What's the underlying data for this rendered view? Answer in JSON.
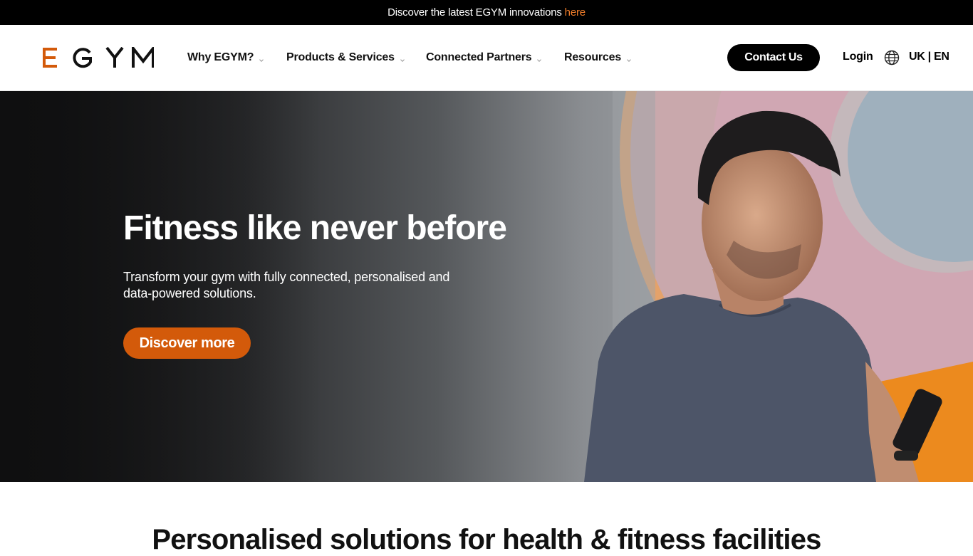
{
  "announcement": {
    "text": "Discover the latest EGYM innovations",
    "link_label": "here"
  },
  "header": {
    "logo_text": "EGYM",
    "nav": [
      {
        "label": "Why EGYM?",
        "icon": "chevron-down-icon"
      },
      {
        "label": "Products & Services",
        "icon": "chevron-down-icon"
      },
      {
        "label": "Connected Partners",
        "icon": "chevron-down-icon"
      },
      {
        "label": "Resources",
        "icon": "chevron-down-icon"
      }
    ],
    "contact_label": "Contact Us",
    "login_label": "Login",
    "globe_icon": "globe-icon",
    "language_label": "UK | EN"
  },
  "hero": {
    "title": "Fitness like never before",
    "subtitle": "Transform your gym with fully connected, personalised and data-powered solutions.",
    "cta_label": "Discover more"
  },
  "section": {
    "title": "Personalised solutions for health & fitness facilities"
  },
  "colors": {
    "brand_orange": "#d35a0a",
    "link_orange": "#f07d2a",
    "black": "#000000"
  }
}
